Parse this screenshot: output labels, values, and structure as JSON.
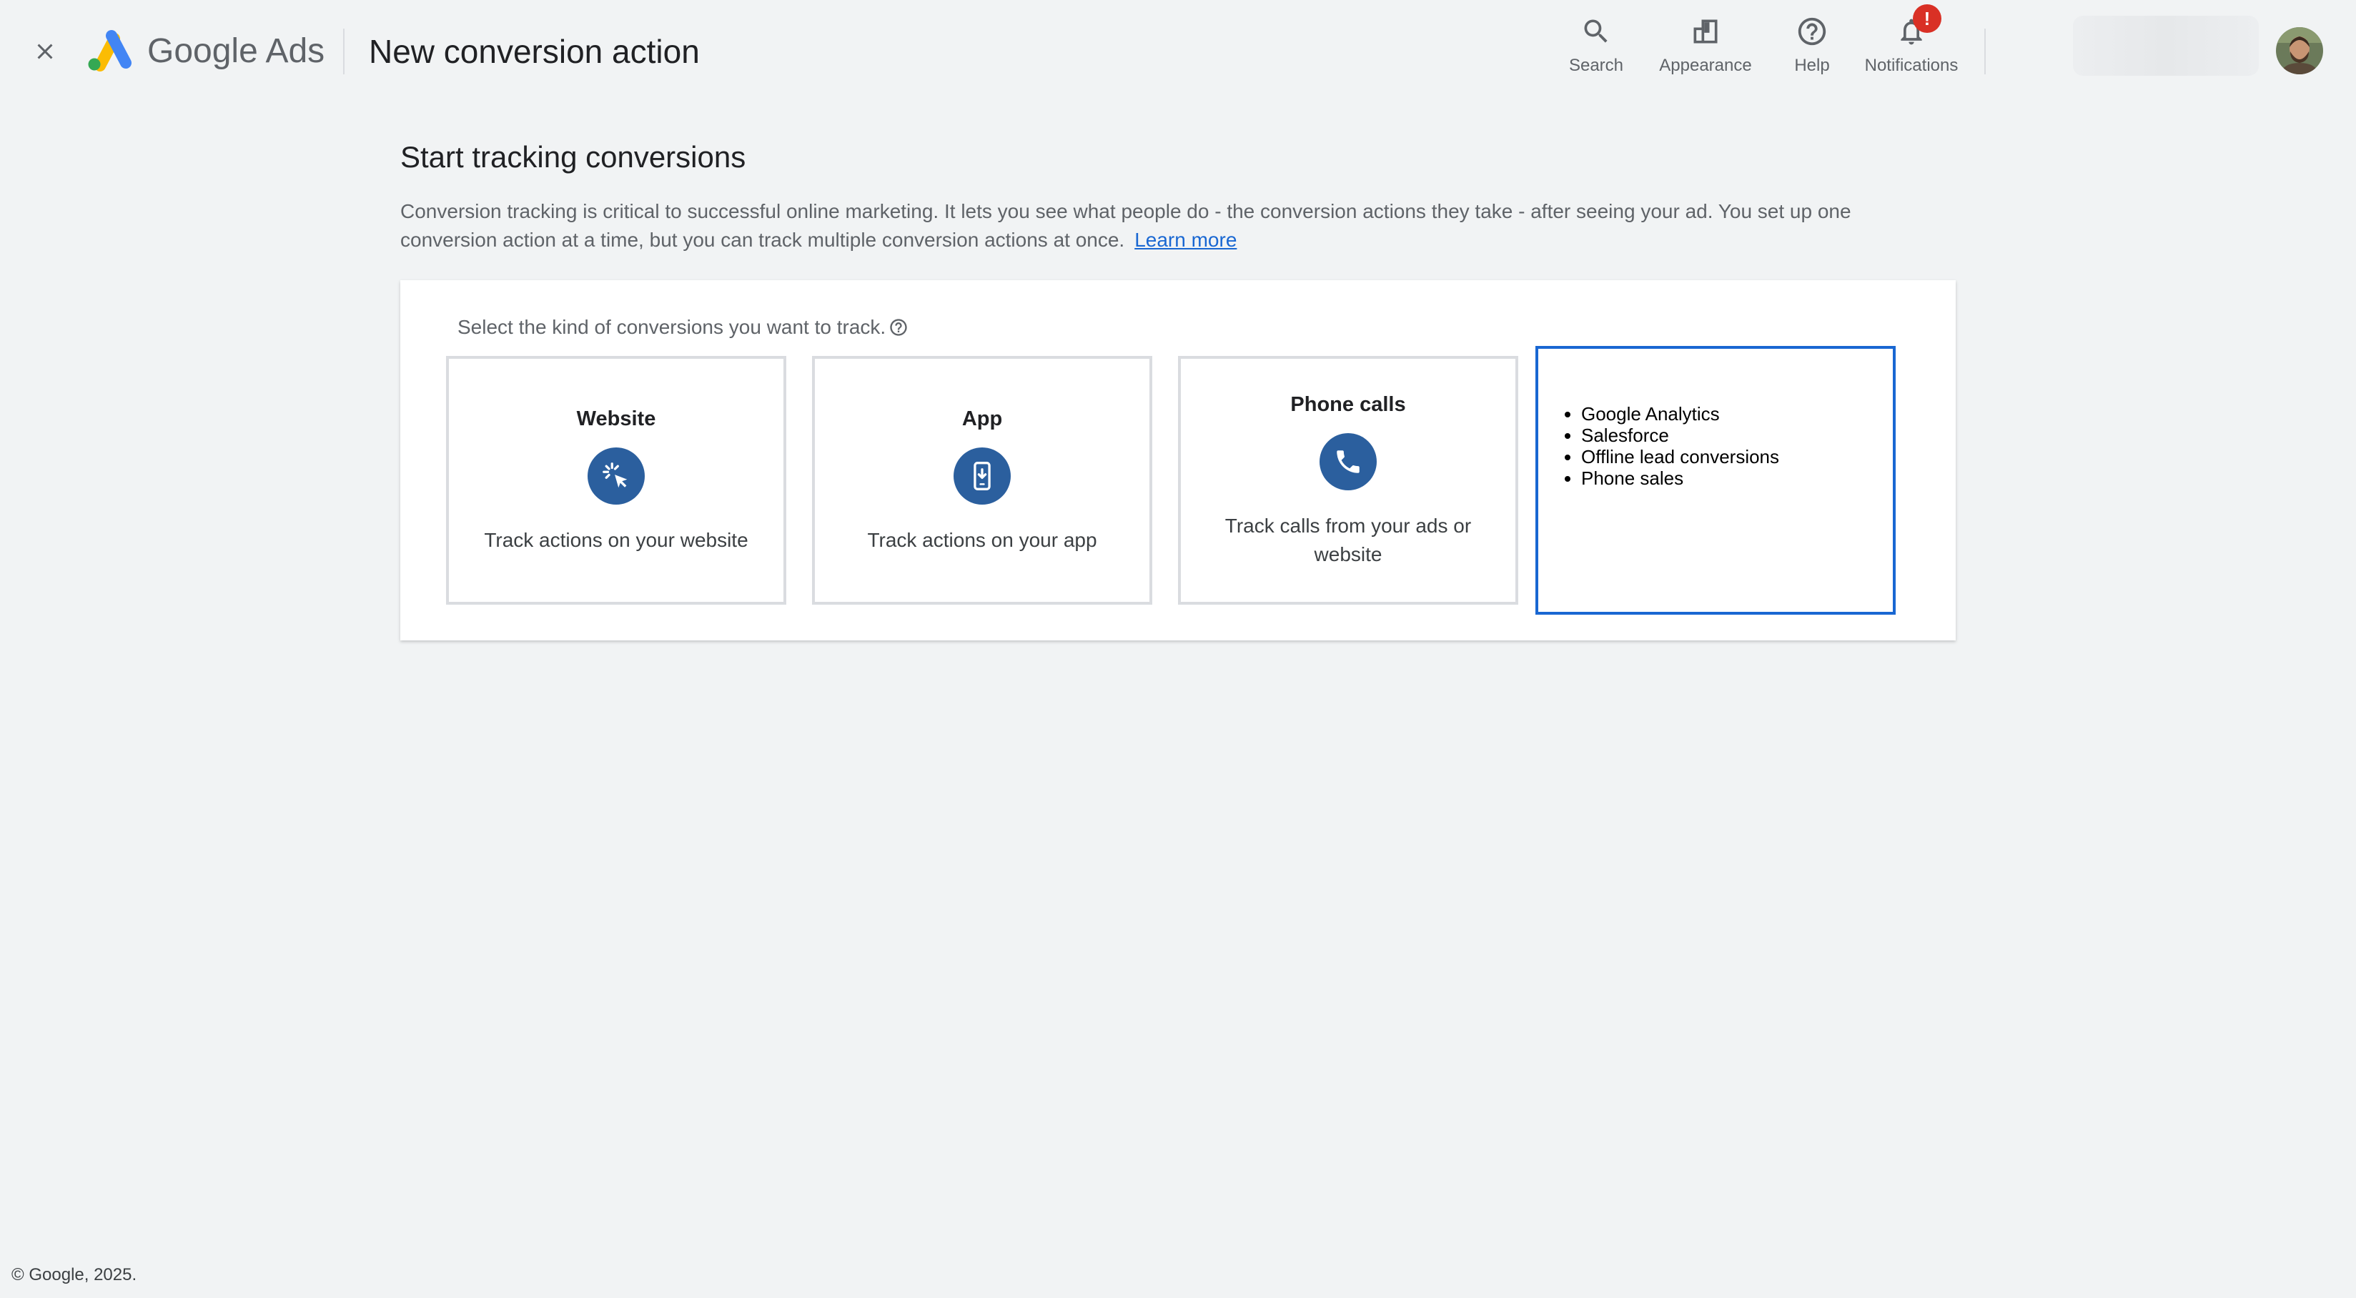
{
  "header": {
    "brand_google": "Google",
    "brand_ads": "Ads",
    "page_title": "New conversion action",
    "actions": {
      "search": "Search",
      "appearance": "Appearance",
      "help": "Help",
      "notifications": "Notifications",
      "notification_badge": "!"
    },
    "colors": {
      "badge": "#d93025",
      "accent": "#1967d2"
    }
  },
  "main": {
    "section_title": "Start tracking conversions",
    "intro_text": "Conversion tracking is critical to successful online marketing. It lets you see what people do - the conversion actions they take - after seeing your ad. You set up one conversion action at a time, but you can track multiple conversion actions at once.",
    "learn_more": "Learn more",
    "prompt": "Select the kind of conversions you want to track.",
    "cards": {
      "website": {
        "title": "Website",
        "icon": "cursor-click-icon",
        "description": "Track actions on your website"
      },
      "app": {
        "title": "App",
        "icon": "phone-download-icon",
        "description": "Track actions on your app"
      },
      "phone_calls": {
        "title": "Phone calls",
        "icon": "phone-icon",
        "description": "Track calls from your ads or website"
      },
      "other": {
        "items": [
          "Google Analytics",
          "Salesforce",
          "Offline lead conversions",
          "Phone sales"
        ]
      }
    }
  },
  "footer": {
    "copyright": "© Google, 2025."
  }
}
